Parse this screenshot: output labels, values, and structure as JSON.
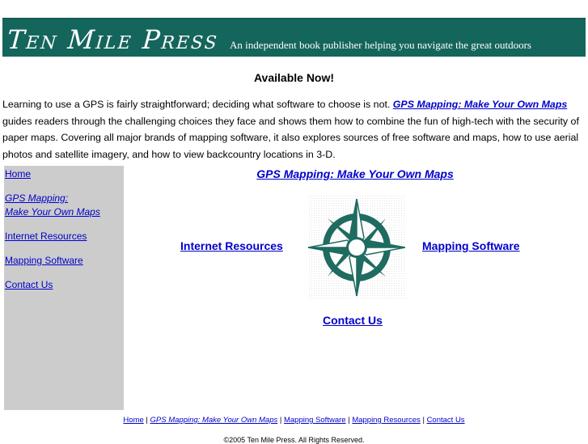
{
  "header": {
    "logo": "Ten Mile Press",
    "tagline": "An independent book publisher helping you navigate the great outdoors"
  },
  "headline": "Available Now!",
  "intro": {
    "lead": "Learning to use a GPS is fairly straightforward; deciding what software to choose is not. ",
    "book_link": "GPS Mapping: Make Your Own Maps",
    "rest": " guides readers through the challenging choices they face and shows them how to combine the fun of high-tech with the security of paper maps. Covering all major brands of mapping software, it also explores sources of free software and maps, how to use aerial photos and satellite imagery, and how to view backcountry locations in 3-D."
  },
  "sidebar": {
    "home": "Home",
    "gps_line1": "GPS Mapping:",
    "gps_line2": "Make Your Own Maps",
    "internet": "Internet Resources",
    "mapping": "Mapping Software",
    "contact": "Contact Us"
  },
  "main": {
    "title": "GPS Mapping: Make Your Own Maps",
    "left": "Internet Resources",
    "right": "Mapping Software",
    "bottom": "Contact Us",
    "compass_icon": "compass-rose-icon"
  },
  "footer": {
    "home": "Home",
    "gps": "GPS Mapping: Make Your Own Maps",
    "mapping": "Mapping Software",
    "resources": "Mapping Resources",
    "contact": "Contact Us",
    "sep": " | ",
    "copyright": "©2005 Ten Mile Press. All Rights Reserved."
  },
  "colors": {
    "banner": "#14655c",
    "sidebar": "#cccccc",
    "link": "#0000cc",
    "compass_dark": "#1f6b60",
    "compass_light": "#ffffff"
  }
}
